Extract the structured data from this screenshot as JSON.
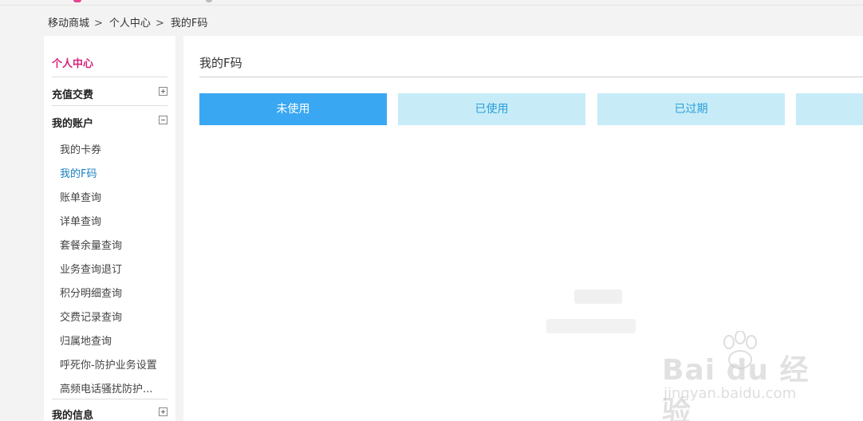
{
  "breadcrumb": {
    "items": [
      "移动商城",
      "个人中心",
      "我的F码"
    ],
    "separator": ">"
  },
  "sidebar": {
    "title": "个人中心",
    "sections": [
      {
        "label": "充值交费",
        "expanded": false
      },
      {
        "label": "我的账户",
        "expanded": true
      },
      {
        "label": "我的信息",
        "expanded": false
      }
    ],
    "account_items": [
      {
        "label": "我的卡券",
        "active": false
      },
      {
        "label": "我的F码",
        "active": true
      },
      {
        "label": "账单查询",
        "active": false
      },
      {
        "label": "详单查询",
        "active": false
      },
      {
        "label": "套餐余量查询",
        "active": false
      },
      {
        "label": "业务查询退订",
        "active": false
      },
      {
        "label": "积分明细查询",
        "active": false
      },
      {
        "label": "交费记录查询",
        "active": false
      },
      {
        "label": "归属地查询",
        "active": false
      },
      {
        "label": "呼死你-防护业务设置",
        "active": false
      },
      {
        "label": "高频电话骚扰防护...",
        "active": false
      }
    ]
  },
  "main": {
    "title": "我的F码",
    "tabs": [
      {
        "label": "未使用",
        "active": true
      },
      {
        "label": "已使用",
        "active": false
      },
      {
        "label": "已过期",
        "active": false
      },
      {
        "label": "",
        "active": false
      }
    ]
  },
  "watermark": {
    "brand": "Bai du 经验",
    "url": "jingyan.baidu.com"
  },
  "colors": {
    "accent_pink": "#d6247a",
    "active_link": "#1a7fc1",
    "tab_active": "#3aa7f2",
    "tab_inactive": "#c7ecf8"
  }
}
